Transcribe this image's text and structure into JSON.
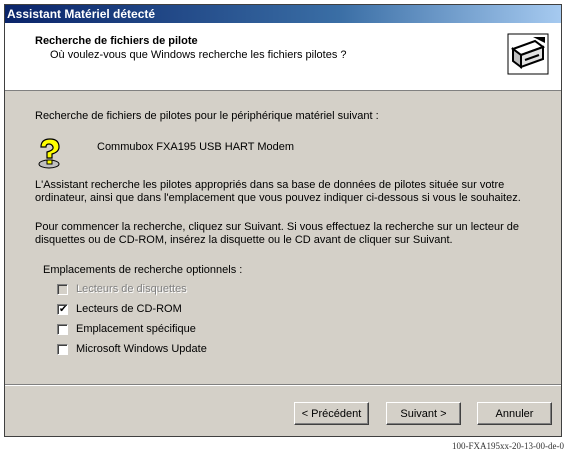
{
  "window": {
    "title": "Assistant Matériel détecté"
  },
  "header": {
    "title": "Recherche de fichiers de pilote",
    "subtitle": "Où voulez-vous que Windows recherche les fichiers pilotes ?"
  },
  "body": {
    "intro": "Recherche de fichiers de pilotes pour le périphérique matériel suivant :",
    "device_name": "Commubox FXA195 USB HART Modem",
    "paragraph1": "L'Assistant recherche les pilotes appropriés dans sa base de données de pilotes située sur votre ordinateur, ainsi que dans l'emplacement que vous pouvez indiquer ci-dessous si vous le souhaitez.",
    "paragraph2": "Pour commencer la recherche, cliquez sur Suivant. Si vous effectuez la recherche sur un lecteur de disquettes ou de CD-ROM, insérez la disquette ou le CD avant de cliquer sur Suivant.",
    "options_label": "Emplacements de recherche optionnels :"
  },
  "options": [
    {
      "label": "Lecteurs de disquettes",
      "checked": false,
      "disabled": true
    },
    {
      "label": "Lecteurs de CD-ROM",
      "checked": true,
      "disabled": false
    },
    {
      "label": "Emplacement spécifique",
      "checked": false,
      "disabled": false
    },
    {
      "label": "Microsoft Windows Update",
      "checked": false,
      "disabled": false
    }
  ],
  "buttons": {
    "back": "< Précédent",
    "next": "Suivant >",
    "cancel": "Annuler"
  },
  "footer_code": "100-FXA195xx-20-13-00-de-0"
}
